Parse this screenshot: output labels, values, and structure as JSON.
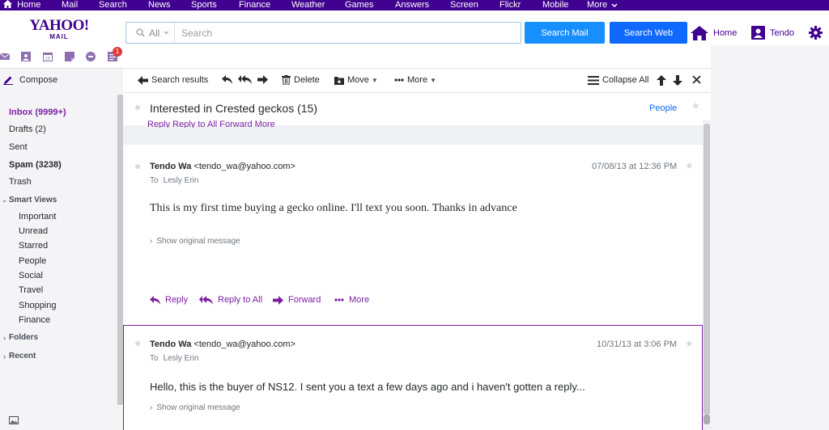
{
  "topnav": {
    "items": [
      "Home",
      "Mail",
      "Search",
      "News",
      "Sports",
      "Finance",
      "Weather",
      "Games",
      "Answers",
      "Screen",
      "Flickr",
      "Mobile",
      "More"
    ]
  },
  "header": {
    "logo_main": "YAHOO!",
    "logo_sub": "MAIL",
    "search_scope": "All",
    "search_placeholder": "Search",
    "search_mail_label": "Search Mail",
    "search_web_label": "Search Web",
    "home_label": "Home",
    "user_label": "Tendo"
  },
  "app_icons": {
    "notification_count": "1"
  },
  "sidebar": {
    "compose_label": "Compose",
    "folders": [
      {
        "label": "Inbox (9999+)"
      },
      {
        "label": "Drafts (2)"
      },
      {
        "label": "Sent"
      },
      {
        "label": "Spam (3238)"
      },
      {
        "label": "Trash"
      }
    ],
    "smart_views_label": "Smart Views",
    "smart_views": [
      "Important",
      "Unread",
      "Starred",
      "People",
      "Social",
      "Travel",
      "Shopping",
      "Finance"
    ],
    "folders_label": "Folders",
    "recent_label": "Recent"
  },
  "toolbar": {
    "search_results": "Search results",
    "delete": "Delete",
    "move": "Move",
    "more": "More",
    "collapse_all": "Collapse All"
  },
  "conversation": {
    "subject": "Interested in Crested geckos (15)",
    "people_link": "People",
    "ghost_actions": "Reply       Reply to All       Forward            More",
    "messages": [
      {
        "sender_name": "Tendo Wa",
        "sender_email": "<tendo_wa@yahoo.com>",
        "to_label": "To",
        "to_name": "Lesly Erin",
        "date": "07/08/13 at 12:36 PM",
        "body": "This is my first time buying a gecko online. I'll text you soon. Thanks in advance",
        "show_original": "Show original message",
        "actions": {
          "reply": "Reply",
          "reply_all": "Reply to All",
          "forward": "Forward",
          "more": "More"
        }
      },
      {
        "sender_name": "Tendo Wa",
        "sender_email": "<tendo_wa@yahoo.com>",
        "to_label": "To",
        "to_name": "Lesly Erin",
        "date": "10/31/13 at 3:06 PM",
        "body": "Hello, this is the buyer of NS12. I sent you a text a few days ago and i haven't gotten a reply...",
        "show_original": "Show original message"
      }
    ]
  },
  "colors": {
    "brand_purple": "#400090",
    "accent_purple": "#7b1fa2",
    "search_mail_blue": "#188fff",
    "search_web_blue": "#0f69ff",
    "badge_red": "#e23a3a"
  }
}
